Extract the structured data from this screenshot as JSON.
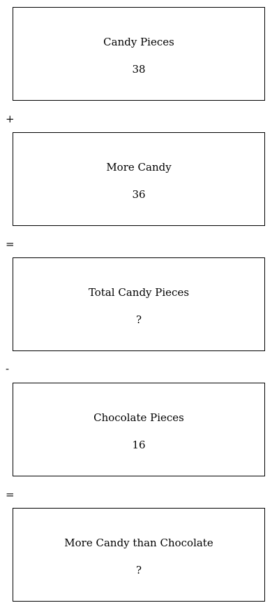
{
  "boxes": [
    {
      "label": "Candy Pieces",
      "value": "38"
    },
    {
      "label": "More Candy",
      "value": "36"
    },
    {
      "label": "Total Candy Pieces",
      "value": "?"
    },
    {
      "label": "Chocolate Pieces",
      "value": "16"
    },
    {
      "label": "More Candy than Chocolate",
      "value": "?"
    }
  ],
  "operators": [
    "+",
    "=",
    "-",
    "="
  ]
}
